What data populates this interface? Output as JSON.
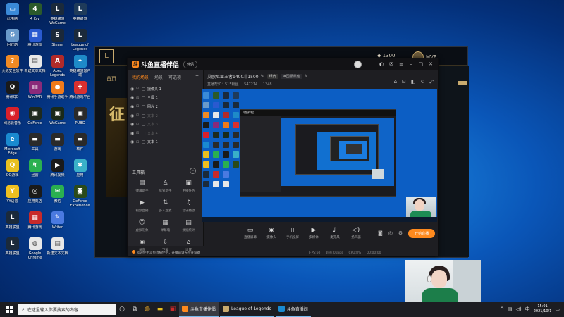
{
  "desktop": {
    "icons": [
      {
        "label": "此电脑",
        "icon": "computer-icon",
        "color": "#3a8ad8",
        "glyph": "▭"
      },
      {
        "label": "4 Cry",
        "icon": "game-icon",
        "color": "#2b5a2b",
        "glyph": "4"
      },
      {
        "label": "英雄联盟WeGame",
        "icon": "lol-icon",
        "color": "#1b2a3b",
        "glyph": "L"
      },
      {
        "label": "英雄联盟",
        "icon": "lol-icon",
        "color": "#1f3b5a",
        "glyph": "L"
      },
      {
        "label": "回收站",
        "icon": "recycle-bin-icon",
        "color": "#6a9acb",
        "glyph": "♻"
      },
      {
        "label": "腾讯游戏",
        "icon": "tencent-game-icon",
        "color": "#2a5ad0",
        "glyph": "▦"
      },
      {
        "label": "Steam",
        "icon": "steam-icon",
        "color": "#1b2838",
        "glyph": "S"
      },
      {
        "label": "League of Legends",
        "icon": "lol-icon",
        "color": "#1b2a3b",
        "glyph": "L"
      },
      {
        "label": "火绒安全软件",
        "icon": "huorong-icon",
        "color": "#f08a24",
        "glyph": "?"
      },
      {
        "label": "新建文本文档",
        "icon": "text-file-icon",
        "color": "#e8e8e8",
        "glyph": "▤"
      },
      {
        "label": "Apex Legends",
        "icon": "apex-icon",
        "color": "#b12a2a",
        "glyph": "A"
      },
      {
        "label": "英雄联盟客户端",
        "icon": "lol-icon",
        "color": "#1e8ac8",
        "glyph": "✦"
      },
      {
        "label": "腾讯QQ",
        "icon": "qq-icon",
        "color": "#1a1a1a",
        "glyph": "Q"
      },
      {
        "label": "WinRAR",
        "icon": "winrar-icon",
        "color": "#8a2a7a",
        "glyph": "▥"
      },
      {
        "label": "腾讯手游助手",
        "icon": "game-assistant-icon",
        "color": "#f07a1a",
        "glyph": "●"
      },
      {
        "label": "腾讯游戏平台",
        "icon": "game-icon",
        "color": "#d83030",
        "glyph": "✚"
      },
      {
        "label": "网易云音乐",
        "icon": "netease-music-icon",
        "color": "#d8202a",
        "glyph": "◉"
      },
      {
        "label": "GeForce",
        "icon": "game-icon",
        "color": "#1e2a1e",
        "glyph": "▣"
      },
      {
        "label": "WeGame",
        "icon": "wegame-icon",
        "color": "#1a2a1a",
        "glyph": "▣"
      },
      {
        "label": "PUBG",
        "icon": "game-icon",
        "color": "#2a2a2a",
        "glyph": "▣"
      },
      {
        "label": "Microsoft Edge",
        "icon": "edge-icon",
        "color": "#1a8ad0",
        "glyph": "e"
      },
      {
        "label": "工具",
        "icon": "tool-icon",
        "color": "#2a2a2a",
        "glyph": "▬"
      },
      {
        "label": "游戏",
        "icon": "game-icon",
        "color": "#2a2a2a",
        "glyph": "▬"
      },
      {
        "label": "软件",
        "icon": "game-icon",
        "color": "#2a2a2a",
        "glyph": "▬"
      },
      {
        "label": "QQ游戏",
        "icon": "qq-game-icon",
        "color": "#e8c020",
        "glyph": "Q"
      },
      {
        "label": "迅雷",
        "icon": "thunder-icon",
        "color": "#2ab050",
        "glyph": "↯"
      },
      {
        "label": "腾讯视频",
        "icon": "tencent-video-icon",
        "color": "#1a1a1a",
        "glyph": "▶"
      },
      {
        "label": "应用",
        "icon": "app-icon",
        "color": "#3ab0c8",
        "glyph": "✱"
      },
      {
        "label": "YY语音",
        "icon": "yy-icon",
        "color": "#f0c020",
        "glyph": "Y"
      },
      {
        "label": "应用商店",
        "icon": "app-store-icon",
        "color": "#1a1a1a",
        "glyph": "◎"
      },
      {
        "label": "微信",
        "icon": "wechat-icon",
        "color": "#2ab050",
        "glyph": "✉"
      },
      {
        "label": "GeForce Experience",
        "icon": "nvidia-icon",
        "color": "#2a4a1a",
        "glyph": "◙"
      },
      {
        "label": "英雄联盟",
        "icon": "lol-icon",
        "color": "#1b2a3b",
        "glyph": "L"
      },
      {
        "label": "腾讯游戏",
        "icon": "game-icon",
        "color": "#c82a2a",
        "glyph": "▦"
      },
      {
        "label": "Writer",
        "icon": "writer-icon",
        "color": "#4a7ae0",
        "glyph": "✎"
      },
      {
        "label": "",
        "icon": "empty-slot",
        "color": "transparent",
        "glyph": ""
      },
      {
        "label": "英雄联盟",
        "icon": "lol-icon",
        "color": "#1b2a3b",
        "glyph": "L"
      },
      {
        "label": "Google Chrome",
        "icon": "chrome-icon",
        "color": "#e8e8e8",
        "glyph": "◍"
      },
      {
        "label": "新建文本文档",
        "icon": "text-file-icon",
        "color": "#e8e8e8",
        "glyph": "▤"
      }
    ]
  },
  "lol": {
    "home_label": "首页",
    "banner_text": "征",
    "coins": "1300",
    "rank_label": "MVP"
  },
  "app": {
    "title": "斗鱼直播伴侣",
    "logo_glyph": "斗",
    "badge": "伴侣",
    "live_title": "艾欧尼亚王者1400冲1500",
    "live_tag": "绿皮",
    "live_tag2": "#国服最佳",
    "room_fans": "直播帮忙：515粉丝",
    "room_stat1": "547214",
    "room_stat2": "1248",
    "tabs": [
      {
        "label": "我的场景",
        "active": true
      },
      {
        "label": "场景",
        "active": false
      },
      {
        "label": "可选项",
        "active": false
      }
    ],
    "scenes": [
      {
        "label": "摄像头 1",
        "icon": "camera-icon",
        "dim": false
      },
      {
        "label": "全屏 1",
        "icon": "screen-icon",
        "dim": false
      },
      {
        "label": "图片 2",
        "icon": "image-icon",
        "dim": false
      },
      {
        "label": "文本 2",
        "icon": "text-icon",
        "dim": true
      },
      {
        "label": "文本 3",
        "icon": "text-icon",
        "dim": true
      },
      {
        "label": "文本 4",
        "icon": "text-icon",
        "dim": true
      },
      {
        "label": "文本 1",
        "icon": "text-icon",
        "dim": false
      }
    ],
    "toolbox_title": "工具箱",
    "tools": [
      {
        "label": "弹幕助手",
        "icon": "danmaku-icon",
        "glyph": "▤"
      },
      {
        "label": "房管助手",
        "icon": "manager-icon",
        "glyph": "♙"
      },
      {
        "label": "主播任务",
        "icon": "task-icon",
        "glyph": "▣"
      },
      {
        "label": "视频直播",
        "icon": "video-icon",
        "glyph": "▶"
      },
      {
        "label": "多人连麦",
        "icon": "multi-mic-icon",
        "glyph": "⇅"
      },
      {
        "label": "音乐播放",
        "icon": "music-icon",
        "glyph": "♫"
      },
      {
        "label": "虚拟形象",
        "icon": "avatar-icon",
        "glyph": "☺"
      },
      {
        "label": "弹幕墙",
        "icon": "danmaku-wall-icon",
        "glyph": "▦"
      },
      {
        "label": "数据统计",
        "icon": "stats-icon",
        "glyph": "▤"
      },
      {
        "label": "录像",
        "icon": "record-icon",
        "glyph": "◉"
      },
      {
        "label": "下载",
        "icon": "download-icon",
        "glyph": "⇩"
      },
      {
        "label": "设置",
        "icon": "settings-icon",
        "glyph": "⌂"
      }
    ],
    "notice": "欢迎使用斗鱼直播伴侣，开播前请先检查设备",
    "controls": [
      {
        "label": "直播屏幕",
        "icon": "screen-share-icon",
        "glyph": "▭"
      },
      {
        "label": "摄像头",
        "icon": "camera-icon",
        "glyph": "◉"
      },
      {
        "label": "手机投屏",
        "icon": "phone-cast-icon",
        "glyph": "▯"
      },
      {
        "label": "多媒体",
        "icon": "media-icon",
        "glyph": "▶"
      },
      {
        "label": "麦克风",
        "icon": "mic-icon",
        "glyph": "♪"
      },
      {
        "label": "扬声器",
        "icon": "speaker-icon",
        "glyph": "◁)"
      }
    ],
    "start_button": "开始直播",
    "status": {
      "fps": "FPS:60",
      "bitrate": "码率:0kbps",
      "cpu": "CPU:8%",
      "time": "00:00:00"
    },
    "nested_title": "斗鱼伴侣"
  },
  "taskbar": {
    "search_placeholder": "在这里输入你要搜索的内容",
    "apps": [
      {
        "label": "斗鱼直播伴侣",
        "icon": "douyu-icon",
        "color": "#ff8a1e",
        "active": true
      },
      {
        "label": "League of Legends",
        "icon": "lol-icon",
        "color": "#c8aa6e",
        "active": false
      },
      {
        "label": "斗鱼直播间",
        "icon": "edge-icon",
        "color": "#1a8ad0",
        "active": false
      }
    ],
    "time": "15:01",
    "date": "2021/10/1"
  }
}
